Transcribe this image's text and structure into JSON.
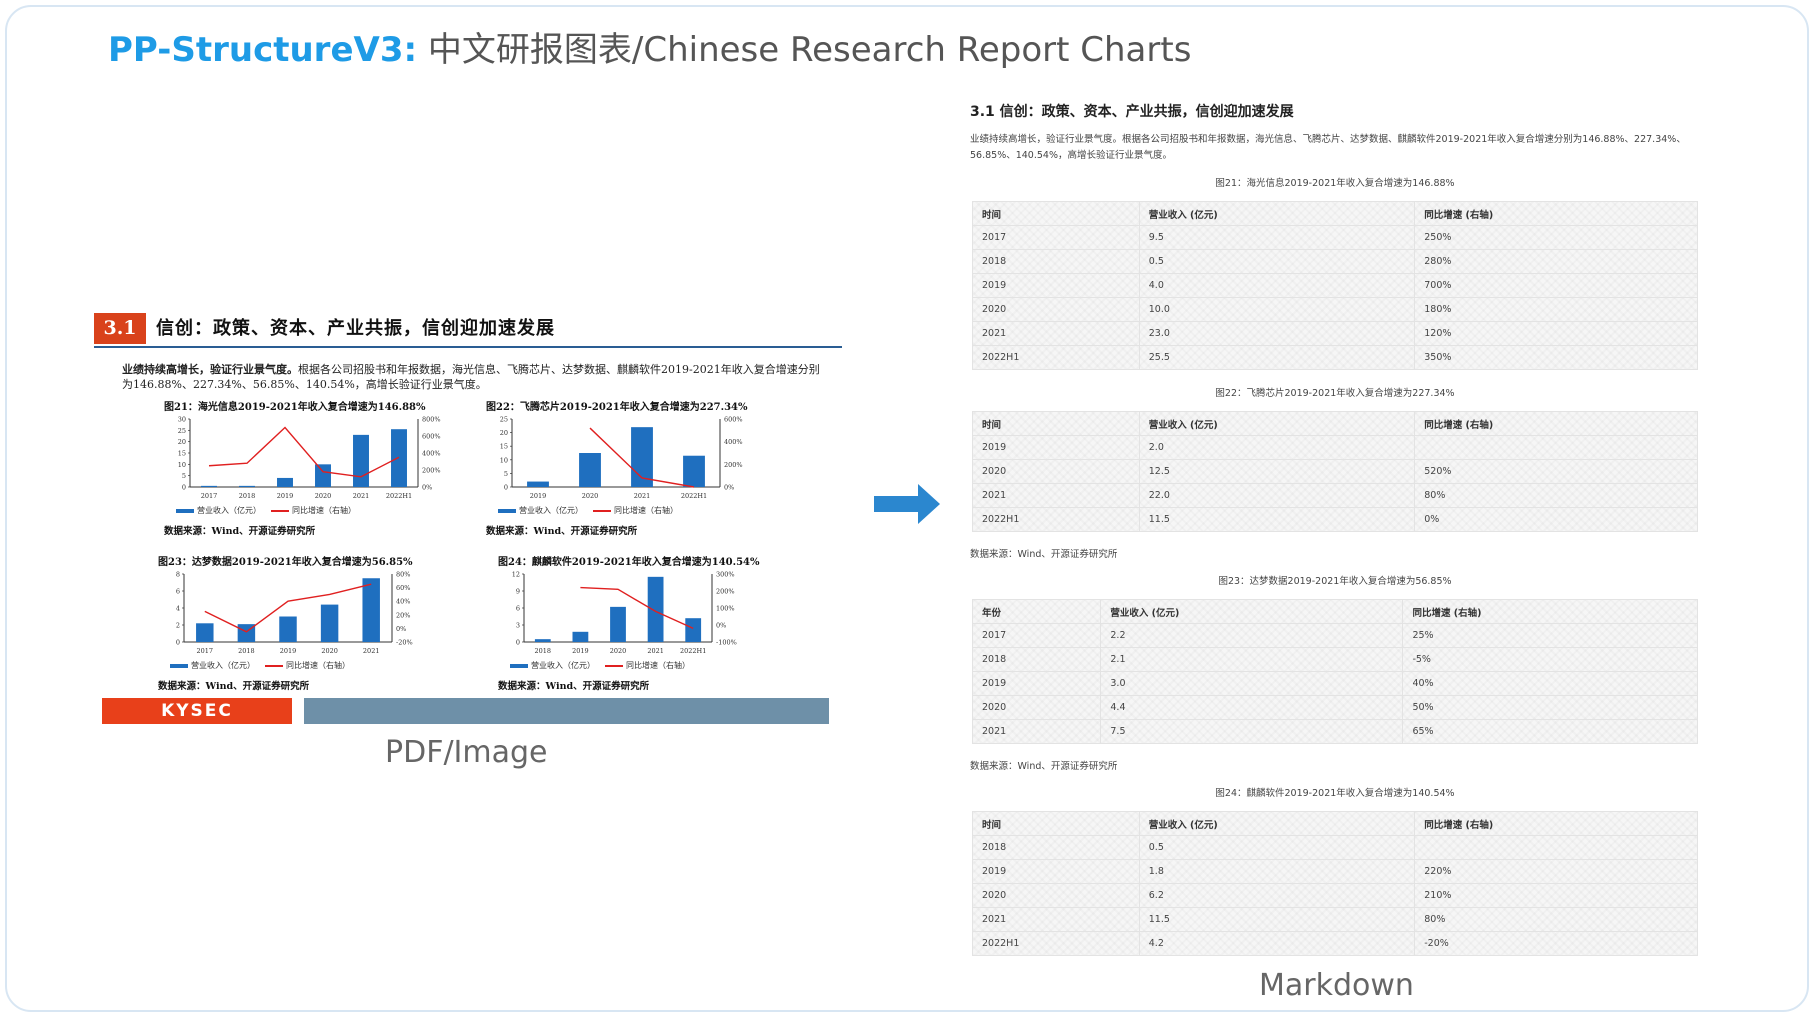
{
  "header": {
    "brand": "PP-StructureV3:",
    "subtitle": " 中文研报图表/Chinese Research Report Charts"
  },
  "pdf": {
    "section_num": "3.1",
    "section_title": "信创：政策、资本、产业共振，信创迎加速发展",
    "para_bold": "业绩持续高增长，验证行业景气度。",
    "para_rest": "根据各公司招股书和年报数据，海光信息、飞腾芯片、达梦数据、麒麟软件2019-2021年收入复合增速分别为146.88%、227.34%、56.85%、140.54%，高增长验证行业景气度。",
    "legend_bar": "营业收入（亿元）",
    "legend_line": "同比增速（右轴）",
    "source": "数据来源：Wind、开源证券研究所",
    "footer_logo": "KYSEC",
    "label": "PDF/Image"
  },
  "markdown": {
    "heading": "3.1 信创：政策、资本、产业共振，信创迎加速发展",
    "paragraph": "业绩持续高增长，验证行业景气度。根据各公司招股书和年报数据，海光信息、飞腾芯片、达梦数据、麒麟软件2019-2021年收入复合增速分别为146.88%、227.34%、56.85%、140.54%，高增长验证行业景气度。",
    "source": "数据来源：Wind、开源证券研究所",
    "label": "Markdown"
  },
  "chart_data": [
    {
      "type": "bar",
      "title": "图21：海光信息2019-2021年收入复合增速为146.88%",
      "categories": [
        "2017",
        "2018",
        "2019",
        "2020",
        "2021",
        "2022H1"
      ],
      "series": [
        {
          "name": "营业收入（亿元）",
          "values": [
            0.5,
            0.5,
            4.0,
            10.0,
            23.0,
            25.5
          ]
        },
        {
          "name": "同比增速（右轴）",
          "values": [
            250,
            280,
            700,
            180,
            120,
            350
          ]
        }
      ],
      "ylim": [
        0,
        30
      ],
      "yticks": [
        "30",
        "25",
        "20",
        "15",
        "10",
        "5",
        "0"
      ],
      "y2lim": [
        0,
        800
      ],
      "y2ticks": [
        "800%",
        "600%",
        "400%",
        "200%",
        "0%"
      ]
    },
    {
      "type": "bar",
      "title": "图22：飞腾芯片2019-2021年收入复合增速为227.34%",
      "categories": [
        "2019",
        "2020",
        "2021",
        "2022H1"
      ],
      "series": [
        {
          "name": "营业收入（亿元）",
          "values": [
            2.0,
            12.5,
            22.0,
            11.5
          ]
        },
        {
          "name": "同比增速（右轴）",
          "values": [
            null,
            520,
            80,
            0
          ]
        }
      ],
      "ylim": [
        0,
        25
      ],
      "yticks": [
        "25",
        "20",
        "15",
        "10",
        "5",
        "0"
      ],
      "y2lim": [
        0,
        600
      ],
      "y2ticks": [
        "600%",
        "400%",
        "200%",
        "0%"
      ]
    },
    {
      "type": "bar",
      "title": "图23：达梦数据2019-2021年收入复合增速为56.85%",
      "categories": [
        "2017",
        "2018",
        "2019",
        "2020",
        "2021"
      ],
      "series": [
        {
          "name": "营业收入（亿元）",
          "values": [
            2.2,
            2.1,
            3.0,
            4.4,
            7.5
          ]
        },
        {
          "name": "同比增速（右轴）",
          "values": [
            25,
            -5,
            40,
            50,
            65
          ]
        }
      ],
      "ylim": [
        0,
        8
      ],
      "yticks": [
        "8",
        "6",
        "4",
        "2",
        "0"
      ],
      "y2lim": [
        -20,
        80
      ],
      "y2ticks": [
        "80%",
        "60%",
        "40%",
        "20%",
        "0%",
        "-20%"
      ]
    },
    {
      "type": "bar",
      "title": "图24：麒麟软件2019-2021年收入复合增速为140.54%",
      "categories": [
        "2018",
        "2019",
        "2020",
        "2021",
        "2022H1"
      ],
      "series": [
        {
          "name": "营业收入（亿元）",
          "values": [
            0.5,
            1.8,
            6.2,
            11.5,
            4.2
          ]
        },
        {
          "name": "同比增速（右轴）",
          "values": [
            null,
            220,
            210,
            80,
            -20
          ]
        }
      ],
      "ylim": [
        0,
        12
      ],
      "yticks": [
        "12",
        "9",
        "6",
        "3",
        "0"
      ],
      "y2lim": [
        -100,
        300
      ],
      "y2ticks": [
        "300%",
        "200%",
        "100%",
        "0%",
        "-100%"
      ]
    }
  ],
  "tables": [
    {
      "caption": "图21：海光信息2019-2021年收入复合增速为146.88%",
      "headers": [
        "时间",
        "营业收入 (亿元)",
        "同比增速 (右轴)"
      ],
      "rows": [
        [
          "2017",
          "9.5",
          "250%"
        ],
        [
          "2018",
          "0.5",
          "280%"
        ],
        [
          "2019",
          "4.0",
          "700%"
        ],
        [
          "2020",
          "10.0",
          "180%"
        ],
        [
          "2021",
          "23.0",
          "120%"
        ],
        [
          "2022H1",
          "25.5",
          "350%"
        ]
      ]
    },
    {
      "caption": "图22：飞腾芯片2019-2021年收入复合增速为227.34%",
      "headers": [
        "时间",
        "营业收入 (亿元)",
        "同比增速 (右轴)"
      ],
      "rows": [
        [
          "2019",
          "2.0",
          ""
        ],
        [
          "2020",
          "12.5",
          "520%"
        ],
        [
          "2021",
          "22.0",
          "80%"
        ],
        [
          "2022H1",
          "11.5",
          "0%"
        ]
      ]
    },
    {
      "caption": "图23：达梦数据2019-2021年收入复合增速为56.85%",
      "headers": [
        "年份",
        "营业收入 (亿元)",
        "同比增速 (右轴)"
      ],
      "rows": [
        [
          "2017",
          "2.2",
          "25%"
        ],
        [
          "2018",
          "2.1",
          "-5%"
        ],
        [
          "2019",
          "3.0",
          "40%"
        ],
        [
          "2020",
          "4.4",
          "50%"
        ],
        [
          "2021",
          "7.5",
          "65%"
        ]
      ]
    },
    {
      "caption": "图24：麒麟软件2019-2021年收入复合增速为140.54%",
      "headers": [
        "时间",
        "营业收入 (亿元)",
        "同比增速 (右轴)"
      ],
      "rows": [
        [
          "2018",
          "0.5",
          ""
        ],
        [
          "2019",
          "1.8",
          "220%"
        ],
        [
          "2020",
          "6.2",
          "210%"
        ],
        [
          "2021",
          "11.5",
          "80%"
        ],
        [
          "2022H1",
          "4.2",
          "-20%"
        ]
      ]
    }
  ]
}
